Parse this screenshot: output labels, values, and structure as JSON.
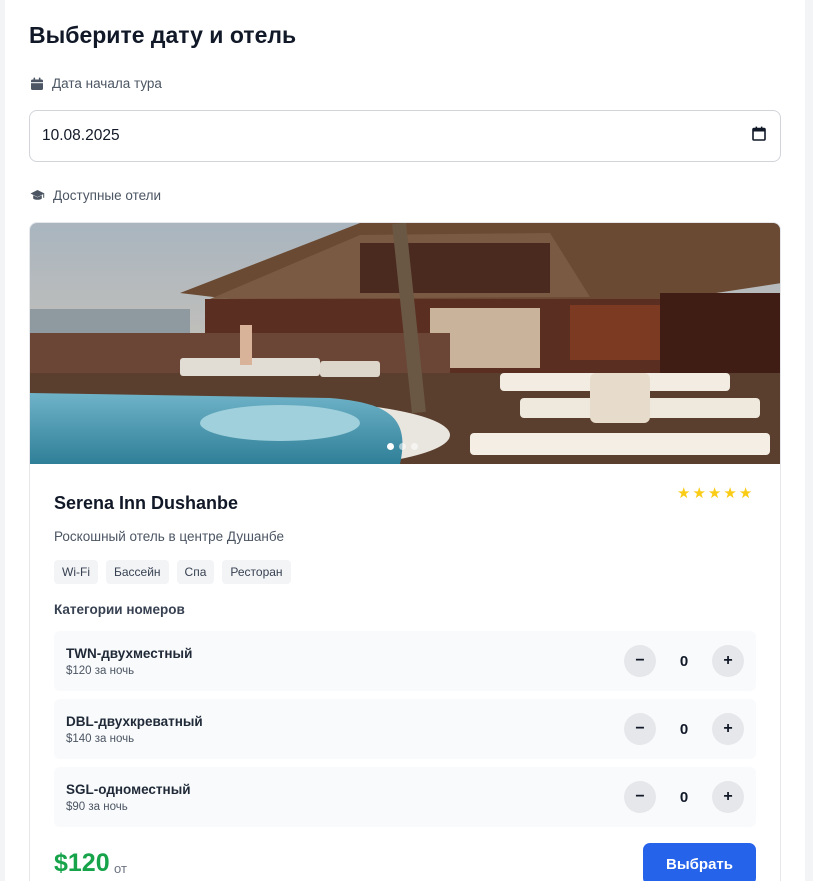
{
  "page": {
    "title": "Выберите дату и отель",
    "date_label": "Дата начала тура",
    "hotels_label": "Доступные отели"
  },
  "date_input": {
    "value": "10.08.2025"
  },
  "hotel": {
    "name": "Serena Inn Dushanbe",
    "description": "Роскошный отель в центре Душанбе",
    "stars": 5,
    "amenities": [
      "Wi-Fi",
      "Бассейн",
      "Спа",
      "Ресторан"
    ],
    "gallery": {
      "slides": 3,
      "active_slide": 1
    },
    "rooms_heading": "Категории номеров",
    "rooms": [
      {
        "name": "TWN-двухместный",
        "price": "$120 за ночь",
        "quantity": "0"
      },
      {
        "name": "DBL-двухкреватный",
        "price": "$140 за ночь",
        "quantity": "0"
      },
      {
        "name": "SGL-одноместный",
        "price": "$90 за ночь",
        "quantity": "0"
      }
    ],
    "price": "$120",
    "price_suffix": "от",
    "select_label": "Выбрать"
  },
  "controls": {
    "minus": "−",
    "plus": "+"
  },
  "colors": {
    "accent_button": "#2563eb",
    "price_green": "#16a34a",
    "star_yellow": "#facc15"
  },
  "icons": {
    "date_label": "calendar-icon",
    "hotels_label": "graduation-cap-icon",
    "date_picker": "calendar-picker-icon",
    "rating": "star-icon"
  }
}
